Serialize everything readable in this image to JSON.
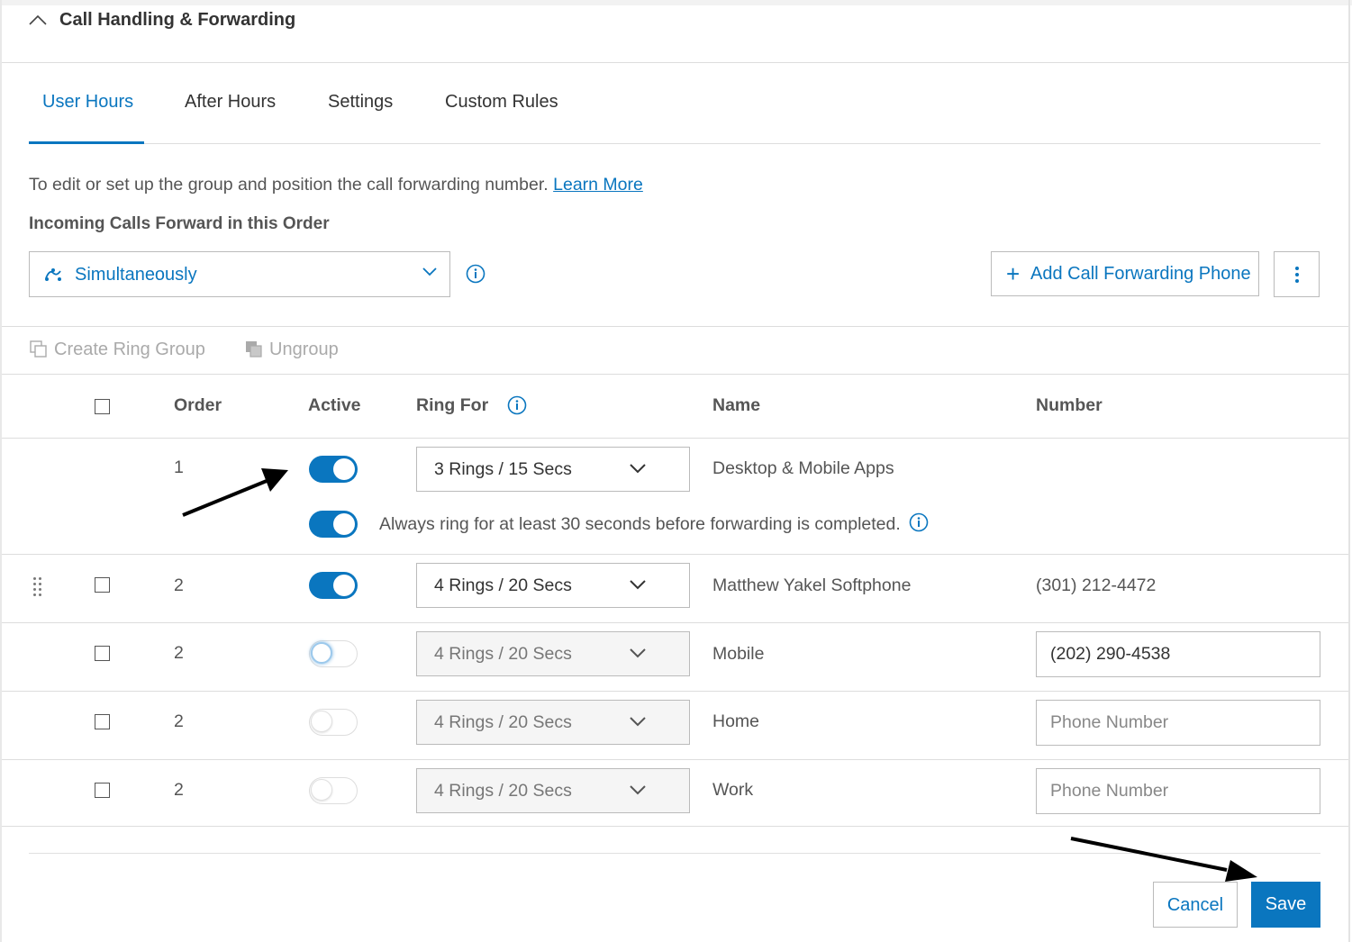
{
  "section": {
    "title": "Call Handling & Forwarding"
  },
  "tabs": [
    {
      "label": "User Hours"
    },
    {
      "label": "After Hours"
    },
    {
      "label": "Settings"
    },
    {
      "label": "Custom Rules"
    }
  ],
  "description": {
    "text": "To edit or set up the group and position the call forwarding number.",
    "link": "Learn More"
  },
  "forward_order": {
    "label": "Incoming Calls Forward in this Order",
    "selected": "Simultaneously"
  },
  "actions": {
    "add_phone": "Add Call Forwarding Phone"
  },
  "toolbar": {
    "create_ring_group": "Create Ring Group",
    "ungroup": "Ungroup"
  },
  "table": {
    "headers": {
      "order": "Order",
      "active": "Active",
      "ring_for": "Ring For",
      "name": "Name",
      "number": "Number"
    },
    "rows": [
      {
        "order": "1",
        "active": true,
        "ring_for": "3 Rings / 15 Secs",
        "name": "Desktop & Mobile Apps",
        "number": "",
        "note": "Always ring for at least 30 seconds before forwarding is completed.",
        "note_active": true
      },
      {
        "order": "2",
        "active": true,
        "ring_for": "4 Rings / 20 Secs",
        "name": "Matthew Yakel Softphone",
        "number": "(301) 212-4472"
      },
      {
        "order": "2",
        "active": false,
        "ring_for": "4 Rings / 20 Secs",
        "name": "Mobile",
        "number_value": "(202) 290-4538",
        "number_placeholder": "Phone Number"
      },
      {
        "order": "2",
        "active": false,
        "ring_for": "4 Rings / 20 Secs",
        "name": "Home",
        "number_value": "",
        "number_placeholder": "Phone Number"
      },
      {
        "order": "2",
        "active": false,
        "ring_for": "4 Rings / 20 Secs",
        "name": "Work",
        "number_value": "",
        "number_placeholder": "Phone Number"
      }
    ]
  },
  "footer": {
    "cancel": "Cancel",
    "save": "Save"
  },
  "colors": {
    "accent": "#0a76bf",
    "text": "#333333",
    "muted": "#555555",
    "border": "#bbbbbb"
  },
  "icons": [
    "chevron-up-icon",
    "simultaneous-icon",
    "chevron-down-icon",
    "info-icon",
    "plus-icon",
    "more-vertical-icon",
    "create-group-icon",
    "ungroup-icon",
    "drag-handle-icon"
  ]
}
